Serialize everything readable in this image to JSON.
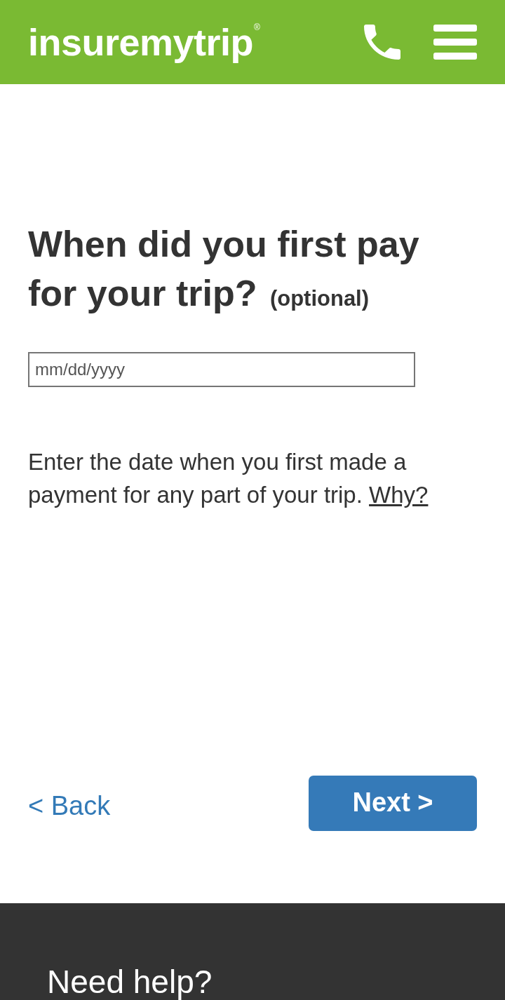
{
  "header": {
    "logo": "insuremytrip",
    "logo_mark": "®"
  },
  "question": {
    "title": "When did you first pay for your trip?",
    "note": "(optional)"
  },
  "date_field": {
    "placeholder": "mm/dd/yyyy"
  },
  "help": {
    "text": "Enter the date when you first made a payment for any part of your trip.",
    "link": "Why?"
  },
  "nav": {
    "back": "< Back",
    "next": "Next >"
  },
  "footer": {
    "heading": "Need help?"
  }
}
